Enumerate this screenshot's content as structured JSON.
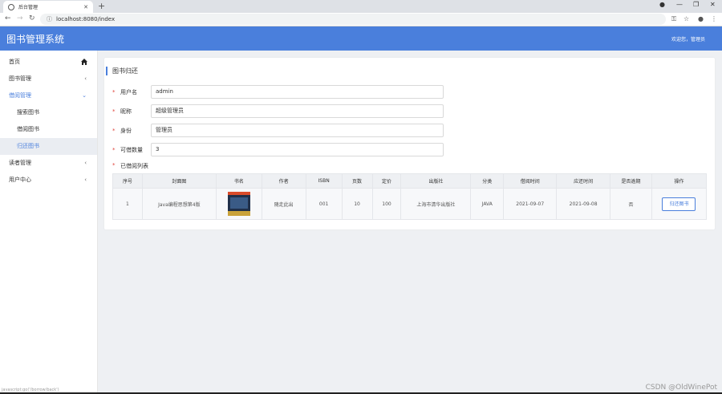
{
  "browser": {
    "tab_title": "后台管理",
    "url": "localhost:8080/index",
    "status_url": "javascript:go('/borrow/back')"
  },
  "header": {
    "title": "图书管理系统",
    "welcome": "欢迎您，管理员"
  },
  "sidebar": {
    "items": [
      {
        "label": "首页"
      },
      {
        "label": "图书管理",
        "arrow": "‹"
      },
      {
        "label": "借阅管理",
        "arrow": "⌄"
      },
      {
        "label": "搜索图书"
      },
      {
        "label": "借阅图书"
      },
      {
        "label": "归还图书"
      },
      {
        "label": "读者管理",
        "arrow": "‹"
      },
      {
        "label": "用户中心",
        "arrow": "‹"
      }
    ]
  },
  "main": {
    "title": "图书归还",
    "form": {
      "username_label": "用户名",
      "username_value": "admin",
      "nickname_label": "昵称",
      "nickname_value": "超级管理员",
      "role_label": "身份",
      "role_value": "管理员",
      "quota_label": "可借数量",
      "quota_value": "3"
    },
    "list_label": "已借阅列表",
    "table": {
      "headers": [
        "序号",
        "封面图",
        "书名",
        "作者",
        "ISBN",
        "页数",
        "定价",
        "出版社",
        "分类",
        "借阅时间",
        "应还时间",
        "是否逾期",
        "操作"
      ],
      "rows": [
        {
          "index": "1",
          "cover": "封面图",
          "title": "Java编程思想第4版",
          "author": "随走此出",
          "isbn": "001",
          "pages": "10",
          "price": "100",
          "publisher": "上海市清华出版社",
          "category": "JAVA",
          "borrow_time": "2021-09-07",
          "due_time": "2021-09-08",
          "overdue": "否",
          "action": "归还图书"
        }
      ]
    }
  },
  "watermark": "CSDN @OldWinePot",
  "colors": {
    "accent": "#4a7fdc",
    "required": "#e0433a"
  },
  "icons": [
    "home-icon",
    "chevron-left-icon",
    "chevron-down-icon"
  ]
}
